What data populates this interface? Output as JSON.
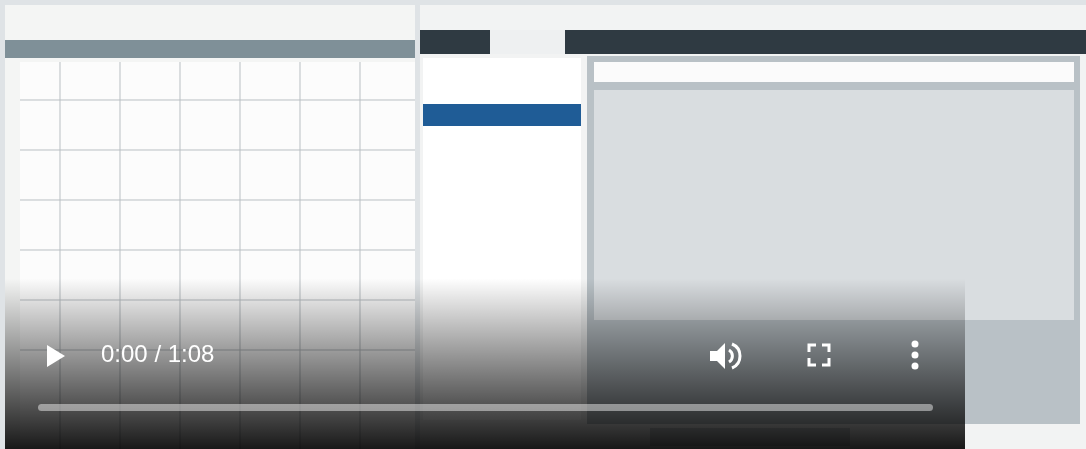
{
  "player": {
    "playing": false,
    "time": "0:00 / 1:08",
    "progress": {
      "level": 0
    }
  }
}
